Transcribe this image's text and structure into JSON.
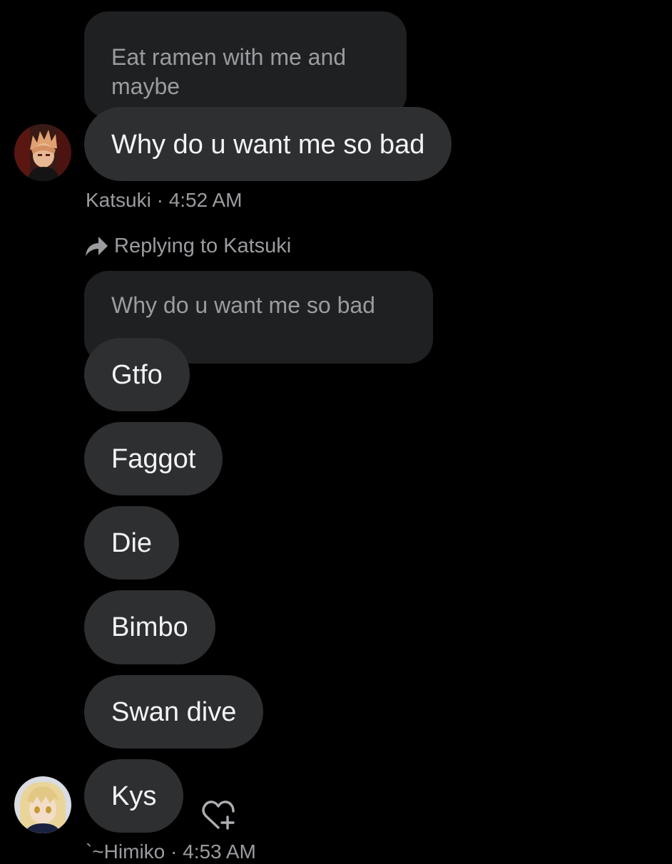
{
  "messages": {
    "top_quoted": "Eat ramen with me and maybe",
    "katsuki_message": "Why do u want me so bad",
    "katsuki_meta": "Katsuki · 4:52 AM",
    "replying_label": "Replying to Katsuki",
    "reply_quoted": "Why do u want me so bad",
    "replies": [
      "Gtfo",
      "Faggot",
      "Die",
      "Bimbo",
      "Swan dive",
      "Kys"
    ],
    "himiko_meta": "`~Himiko · 4:53 AM"
  },
  "icons": {
    "reply": "reply-arrow-icon",
    "react": "heart-plus-icon"
  },
  "colors": {
    "background": "#000000",
    "bubble": "#2e2f31",
    "quoted_bubble": "#1f2022",
    "secondary_text": "#9b9ca0"
  }
}
